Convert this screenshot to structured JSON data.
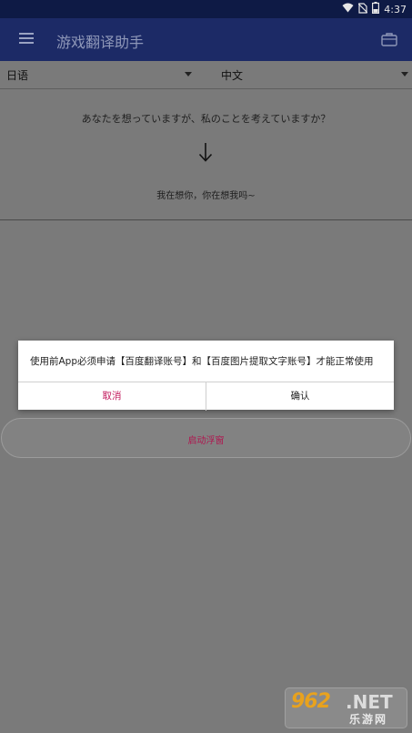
{
  "status_bar": {
    "time": "4:37",
    "icons": [
      "wifi-icon",
      "no-sim-icon",
      "battery-icon"
    ]
  },
  "app_bar": {
    "title": "游戏翻译助手",
    "menu_icon": "menu-icon",
    "action_icon": "briefcase-icon"
  },
  "languages": {
    "source": "日语",
    "target": "中文"
  },
  "translation": {
    "source_text": "あなたを想っていますが、私のことを考えていますか？",
    "result_text": "我在想你，你在想我吗~"
  },
  "float_button": {
    "label": "启动浮窗"
  },
  "dialog": {
    "message": "使用前App必须申请【百度翻译账号】和【百度图片提取文字账号】才能正常使用",
    "cancel_label": "取消",
    "confirm_label": "确认"
  },
  "watermark": {
    "brand": "962",
    "domain": ".NET",
    "name": "乐游网"
  },
  "colors": {
    "app_bar": "#1c2a66",
    "status_bar": "#0e1a45",
    "accent": "#c2185b",
    "scrim_background": "#7a7a7a"
  }
}
